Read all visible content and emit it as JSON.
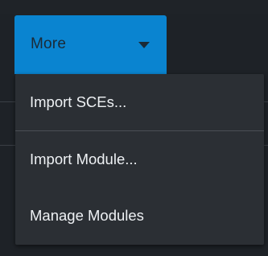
{
  "toolbar": {
    "more_label": "More",
    "caret_icon": "caret-down-icon",
    "accent_color": "#0a84d0"
  },
  "menu": {
    "items": [
      {
        "label": "Import SCEs..."
      },
      {
        "label": "Import Module..."
      },
      {
        "label": "Manage Modules"
      }
    ]
  }
}
